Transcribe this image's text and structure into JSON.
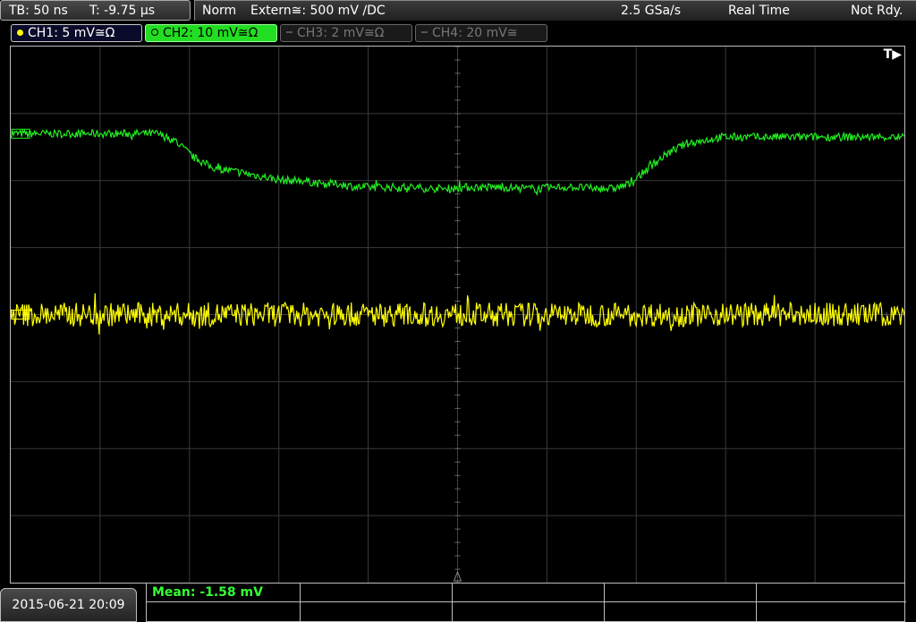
{
  "top": {
    "timebase": "TB: 50 ns",
    "trigger_offset": "T: -9.75 µs",
    "trigger_mode": "Norm",
    "trigger_source": "Extern≅: 500 mV ∕DC",
    "sample_rate": "2.5 GSa/s",
    "acq_mode": "Real Time",
    "status": "Not Rdy."
  },
  "channels": [
    {
      "label": "CH1: 5 mV≅Ω",
      "color": "#ffff00",
      "active": true
    },
    {
      "label": "CH2: 10 mV≅Ω",
      "color": "#22ee22",
      "active": true,
      "selected": true
    },
    {
      "label": "CH3: 2 mV≅Ω",
      "color": "#777777",
      "active": false
    },
    {
      "label": "CH4: 20 mV≅",
      "color": "#777777",
      "active": false
    }
  ],
  "trigger_marker": "T▶",
  "measurement": {
    "label": "Mean: -1.58 mV"
  },
  "datetime": "2015-06-21 20:09",
  "chart_data": {
    "type": "line",
    "grid": {
      "divisions_x": 10,
      "divisions_y": 8
    },
    "series": [
      {
        "name": "CH2",
        "color": "#22ee22",
        "y_div": [
          2.7,
          2.7,
          2.7,
          2.7,
          2.7,
          2.7,
          2.7,
          2.7,
          2.7,
          2.6,
          2.35,
          2.2,
          2.15,
          2.1,
          2.05,
          2.0,
          2.0,
          1.95,
          1.95,
          1.9,
          1.9,
          1.9,
          1.9,
          1.88,
          1.88,
          1.9,
          1.9,
          1.9,
          1.88,
          1.88,
          1.9,
          1.9,
          1.88,
          1.88,
          1.95,
          2.2,
          2.4,
          2.55,
          2.6,
          2.65,
          2.65,
          2.65,
          2.65,
          2.65,
          2.65,
          2.65,
          2.65,
          2.65,
          2.65,
          2.65
        ],
        "noise_div": 0.06
      },
      {
        "name": "CH1",
        "color": "#ffff00",
        "y_div": [
          0.0
        ],
        "noise_div": 0.18
      }
    ]
  }
}
